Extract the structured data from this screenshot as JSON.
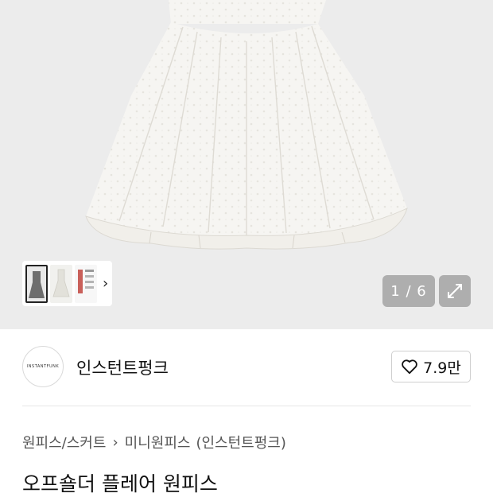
{
  "gallery": {
    "counter": "1 / 6",
    "thumbnails": [
      {
        "label": "dress-front"
      },
      {
        "label": "dress-detail"
      },
      {
        "label": "size-chart"
      }
    ]
  },
  "brand": {
    "logo_text": "INSTANTFUNK",
    "name": "인스턴트펑크",
    "likes": "7.9만"
  },
  "breadcrumb": {
    "category": "원피스/스커트",
    "subcategory": "미니원피스",
    "brand": "(인스턴트펑크)"
  },
  "product": {
    "title": "오프숄더 플레어 원피스"
  },
  "colors": {
    "hero_bg": "#ececec",
    "overlay": "rgba(150,150,150,0.72)",
    "divider": "#e6e6e6"
  },
  "icons": {
    "thumb_next": "chevron-right-icon",
    "expand": "expand-icon",
    "like": "heart-outline-icon"
  }
}
